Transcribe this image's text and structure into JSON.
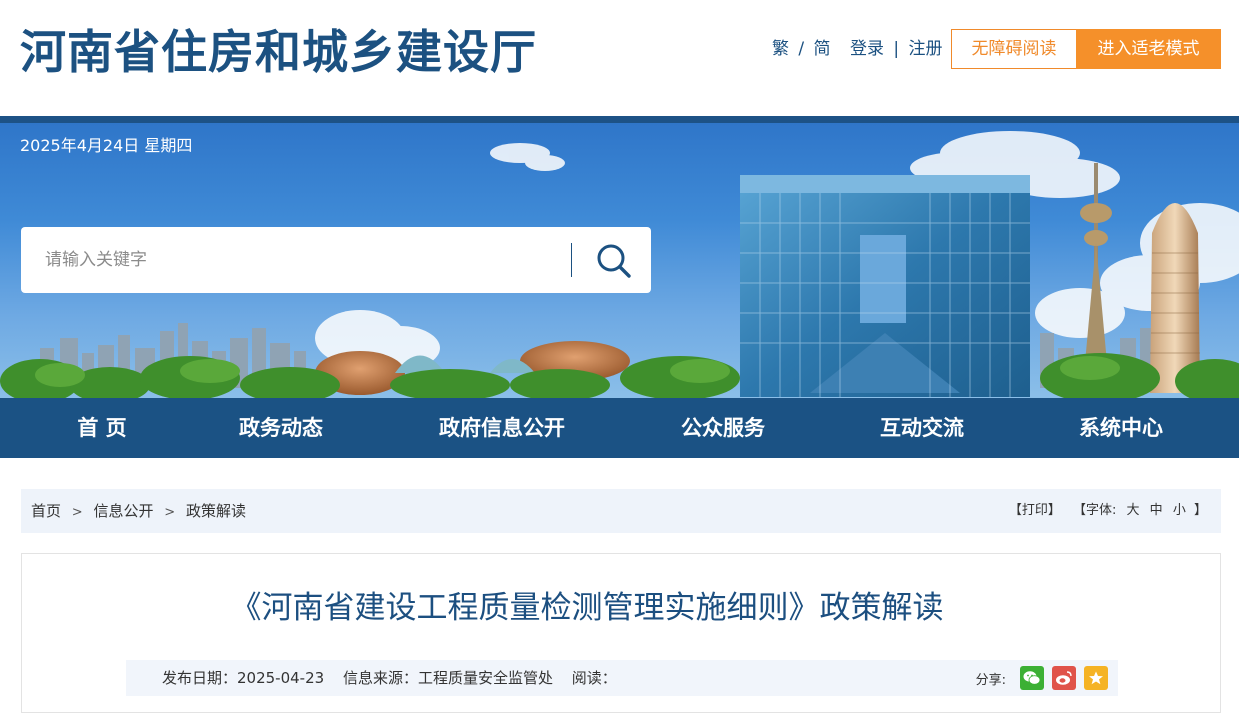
{
  "header": {
    "site_title": "河南省住房和城乡建设厅",
    "lang_traditional": "繁",
    "lang_sep": "/",
    "lang_simplified": "简",
    "login": "登录",
    "auth_sep": "|",
    "register": "注册",
    "accessible_reading": "无障碍阅读",
    "elderly_mode": "进入适老模式"
  },
  "banner": {
    "date": "2025年4月24日 星期四",
    "search_placeholder": "请输入关键字"
  },
  "nav": {
    "items": [
      "首 页",
      "政务动态",
      "政府信息公开",
      "公众服务",
      "互动交流",
      "系统中心"
    ]
  },
  "breadcrumb": {
    "items": [
      "首页",
      "信息公开",
      "政策解读"
    ],
    "separator": ">"
  },
  "tools": {
    "print": "【打印】",
    "font_prefix": "【字体:",
    "font_large": "大",
    "font_medium": "中",
    "font_small": "小",
    "font_suffix": "】"
  },
  "article": {
    "title": "《河南省建设工程质量检测管理实施细则》政策解读",
    "publish_date": "发布日期：2025-04-23",
    "source": "信息来源：工程质量安全监管处",
    "reads": "阅读：",
    "share_label": "分享:"
  },
  "colors": {
    "brand_blue": "#1c5181",
    "nav_blue": "#1b5284",
    "accent_orange": "#f5902a",
    "wechat_green": "#3cb034",
    "weibo_red": "#e0534a",
    "qzone_yellow": "#f5b324"
  },
  "icons": [
    "search-icon",
    "wechat-icon",
    "weibo-icon",
    "qzone-icon"
  ]
}
